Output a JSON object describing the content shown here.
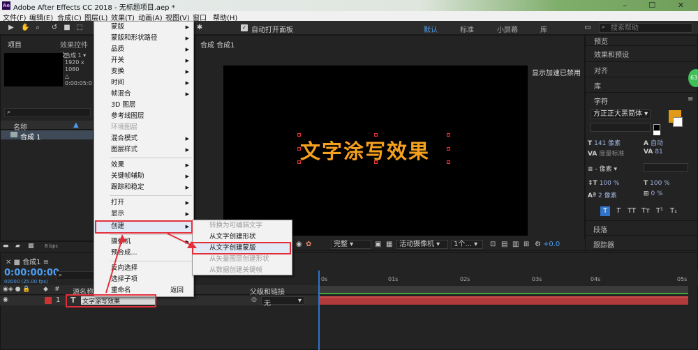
{
  "titlebar": {
    "logo": "Ae",
    "title": "Adobe After Effects CC 2018 - 无标题项目.aep *",
    "controls": "– ☐ ✕"
  },
  "menubar": {
    "items": [
      "文件(F)",
      "编辑(E)",
      "合成(C)",
      "图层(L)",
      "效果(T)",
      "动画(A)",
      "视图(V)",
      "窗口",
      "帮助(H)"
    ]
  },
  "toolbar": {
    "auto_open_panel": "自动打开面板",
    "workspaces": [
      "默认",
      "标准",
      "小屏幕",
      "库"
    ],
    "search_placeholder": "搜索帮助"
  },
  "project": {
    "tab_label": "项目",
    "effects_tab": "效果控件 文",
    "comp_name": "合成 1",
    "comp_info": [
      "合成 1 ▾",
      "1920 x 1080",
      "△ 0:00:05:0"
    ],
    "col_name": "名称",
    "row_label": "合成 1"
  },
  "comp_viewer": {
    "tab_label": "合成 合成1",
    "canvas_text": "文字涂写效果",
    "gpu_note": "显示加速已禁用",
    "quality": "完整",
    "camera": "活动摄像机",
    "view_count": "1个...",
    "exposure": "+0.0",
    "bpc": "8 bpc"
  },
  "right_panel": {
    "items": [
      "预览",
      "效果和预设",
      "对齐",
      "库",
      "字符"
    ],
    "font_name": "方正正大黑简体",
    "font_size": "141 像素",
    "leading": "自动",
    "kerning": "度量标准",
    "tracking": "81",
    "stroke_width": "- 像素",
    "vscale": "100 %",
    "hscale": "100 %",
    "baseline": "2 像素",
    "tsume": "0 %",
    "paragraph": "段落",
    "tracker": "跟踪器",
    "type_buttons": [
      "T",
      "T",
      "TT",
      "Tт",
      "T¹",
      "T₁"
    ],
    "fill_color": "#e09a17",
    "badge": "63"
  },
  "timeline": {
    "tab_label": "合成1",
    "time": "0:00:00:00",
    "frames": "00000 (25.00 fps)",
    "col_source": "源名称",
    "col_parent": "父级和链接",
    "layer_num": "1",
    "layer_name": "文字涂写效果",
    "parent_value": "无",
    "ruler_ticks": [
      "0s",
      "01s",
      "02s",
      "03s",
      "04s",
      "05s"
    ]
  },
  "layer_menu": {
    "items": [
      {
        "label": "蒙版",
        "sub": true,
        "disabled": false
      },
      {
        "label": "蒙版和形状路径",
        "sub": true,
        "disabled": false
      },
      {
        "label": "品质",
        "sub": true,
        "disabled": false
      },
      {
        "label": "开关",
        "sub": true,
        "disabled": false
      },
      {
        "label": "变换",
        "sub": true,
        "disabled": false
      },
      {
        "label": "时间",
        "sub": true,
        "disabled": false
      },
      {
        "label": "帧混合",
        "sub": true,
        "disabled": false
      },
      {
        "label": "3D 图层",
        "sub": false,
        "disabled": false
      },
      {
        "label": "参考线图层",
        "sub": false,
        "disabled": false
      },
      {
        "label": "环境图层",
        "sub": false,
        "disabled": true
      },
      {
        "label": "混合模式",
        "sub": true,
        "disabled": false
      },
      {
        "label": "图层样式",
        "sub": true,
        "disabled": false
      },
      {
        "label": "效果",
        "sub": true,
        "disabled": false
      },
      {
        "label": "关键帧辅助",
        "sub": true,
        "disabled": false
      },
      {
        "label": "跟踪和稳定",
        "sub": true,
        "disabled": false
      },
      {
        "label": "打开",
        "sub": true,
        "disabled": false
      },
      {
        "label": "显示",
        "sub": true,
        "disabled": false
      },
      {
        "label": "创建",
        "sub": true,
        "disabled": false
      },
      {
        "label": "摄像机",
        "sub": true,
        "disabled": false
      },
      {
        "label": "预合成...",
        "sub": false,
        "disabled": false
      },
      {
        "label": "反向选择",
        "sub": false,
        "disabled": false
      },
      {
        "label": "选择子项",
        "sub": false,
        "disabled": false
      },
      {
        "label": "重命名",
        "sub": false,
        "disabled": false,
        "shortcut": "返回"
      }
    ]
  },
  "create_menu": {
    "items": [
      {
        "label": "转换为可编辑文字",
        "disabled": true
      },
      {
        "label": "从文字创建形状",
        "disabled": false
      },
      {
        "label": "从文字创建蒙版",
        "disabled": false
      },
      {
        "label": "从矢量图层创建形状",
        "disabled": true
      },
      {
        "label": "从数据创建关键帧",
        "disabled": true
      }
    ]
  }
}
